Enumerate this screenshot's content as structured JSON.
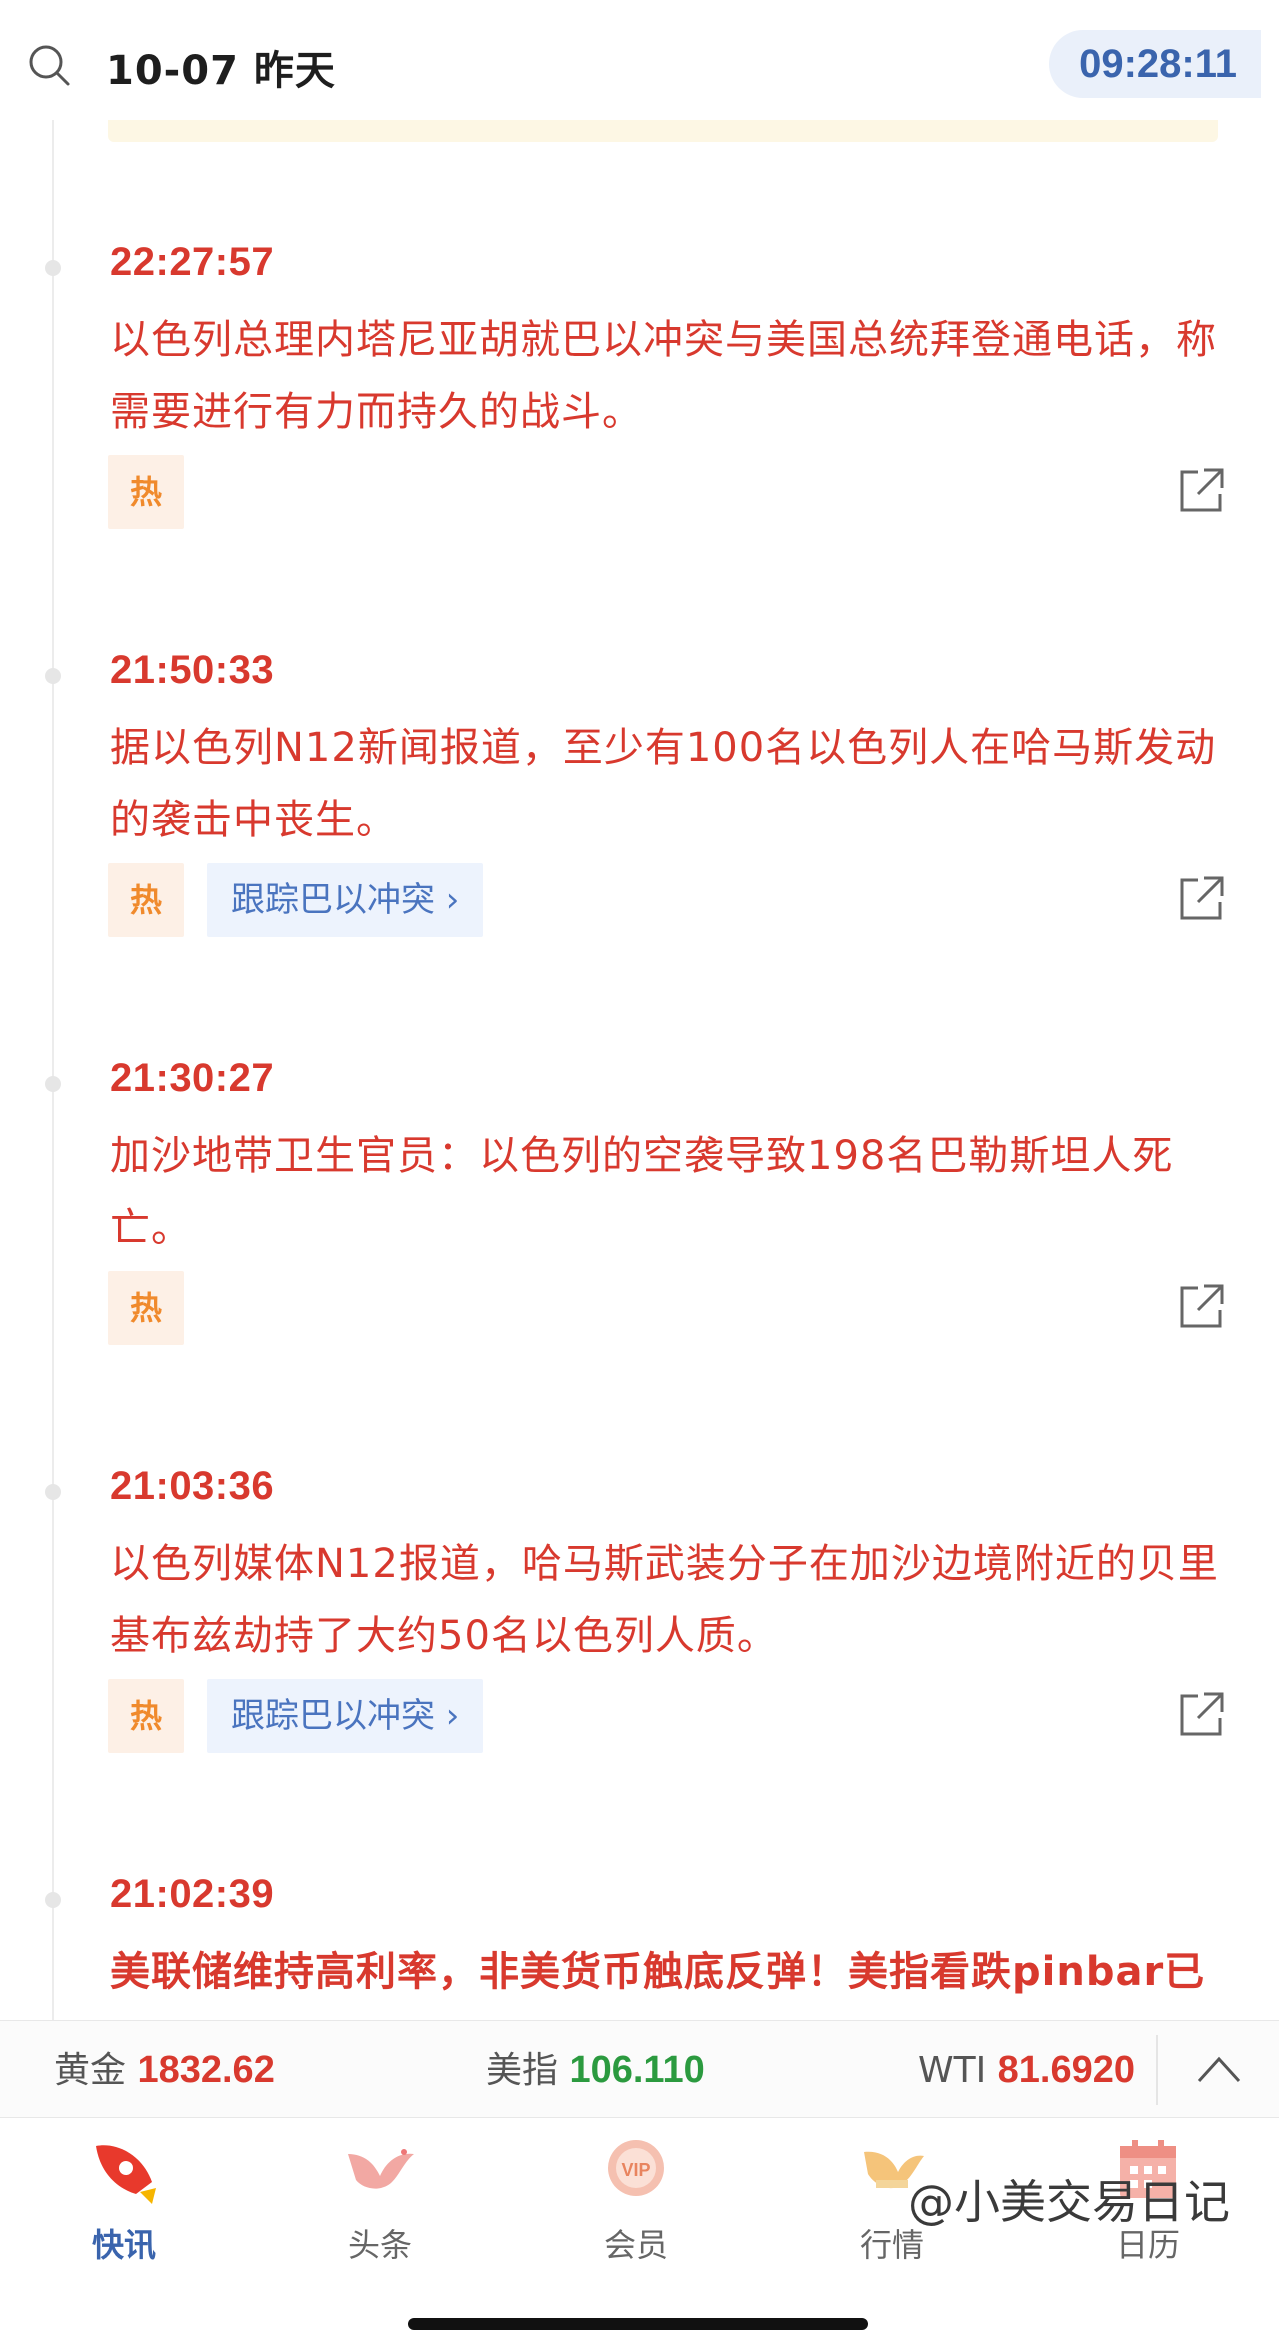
{
  "header": {
    "date_label": "10-07 昨天",
    "clock": "09:28:11"
  },
  "feed": [
    {
      "time": "22:27:57",
      "text": "以色列总理内塔尼亚胡就巴以冲突与美国总统拜登通电话，称需要进行有力而持久的战斗。",
      "hot": "热",
      "track": null,
      "bold": false
    },
    {
      "time": "21:50:33",
      "text": "据以色列N12新闻报道，至少有100名以色列人在哈马斯发动的袭击中丧生。",
      "hot": "热",
      "track": "跟踪巴以冲突 ›",
      "bold": false
    },
    {
      "time": "21:30:27",
      "text": "加沙地带卫生官员：以色列的空袭导致198名巴勒斯坦人死亡。",
      "hot": "热",
      "track": null,
      "bold": false
    },
    {
      "time": "21:03:36",
      "text": "以色列媒体N12报道，哈马斯武装分子在加沙边境附近的贝里基布兹劫持了大约50名以色列人质。",
      "hot": "热",
      "track": "跟踪巴以冲突 ›",
      "bold": false
    },
    {
      "time": "21:02:39",
      "text": "美联储维持高利率，非美货币触底反弹！美指看跌pinbar已经形成，黄金多头来袭？交易机会如何把握",
      "hot": null,
      "track": null,
      "bold": true
    }
  ],
  "ticker": {
    "gold_label": "黄金",
    "gold_value": "1832.62",
    "usd_label": "美指",
    "usd_value": "106.110",
    "wti_label": "WTI",
    "wti_value": "81.6920"
  },
  "tabs": [
    {
      "label": "快讯",
      "icon": "rocket-icon",
      "active": true
    },
    {
      "label": "头条",
      "icon": "dove-icon",
      "active": false
    },
    {
      "label": "会员",
      "icon": "vip-badge-icon",
      "active": false
    },
    {
      "label": "行情",
      "icon": "chart-bird-icon",
      "active": false
    },
    {
      "label": "日历",
      "icon": "calendar-icon",
      "active": false
    }
  ],
  "watermark": "@小美交易日记",
  "colors": {
    "accent_red": "#d8392e",
    "accent_blue": "#3a64ad",
    "hot_orange": "#f08a2c",
    "up_green": "#2b9a3f"
  }
}
